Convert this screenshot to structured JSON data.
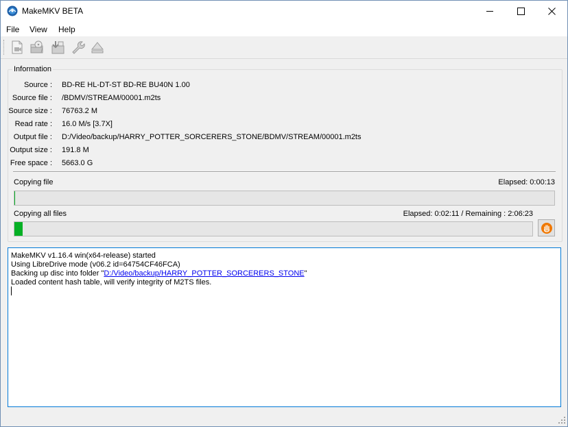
{
  "window": {
    "title": "MakeMKV BETA"
  },
  "title_buttons": {
    "minimize": "─",
    "maximize": "☐",
    "close": "✕"
  },
  "menu": {
    "file": "File",
    "view": "View",
    "help": "Help"
  },
  "toolbar": {
    "icons": [
      "open-files-icon",
      "open-disc-icon",
      "backup-icon",
      "preferences-icon",
      "eject-icon"
    ]
  },
  "info": {
    "group_title": "Information",
    "rows": [
      {
        "label": "Source :",
        "value": "BD-RE HL-DT-ST BD-RE BU40N 1.00"
      },
      {
        "label": "Source file :",
        "value": "/BDMV/STREAM/00001.m2ts"
      },
      {
        "label": "Source size :",
        "value": "76763.2 M"
      },
      {
        "label": "Read rate :",
        "value": "16.0 M/s [3.7X]"
      },
      {
        "label": "Output file :",
        "value": "D:/Video/backup/HARRY_POTTER_SORCERERS_STONE/BDMV/STREAM/00001.m2ts"
      },
      {
        "label": "Output size :",
        "value": "191.8 M"
      },
      {
        "label": "Free space :",
        "value": "5663.0 G"
      }
    ]
  },
  "progress": {
    "file_label": "Copying file",
    "file_elapsed": "Elapsed: 0:00:13",
    "file_fraction": 0.001,
    "all_label": "Copying all files",
    "all_elapsed": "Elapsed: 0:02:11 / Remaining : 2:06:23",
    "all_fraction": 0.016
  },
  "log": {
    "line1": "MakeMKV v1.16.4 win(x64-release) started",
    "line2": "Using LibreDrive mode (v06.2 id=64754CF46FCA)",
    "line3_prefix": "Backing up disc into folder \"",
    "line3_link": "D:/Video/backup/HARRY_POTTER_SORCERERS_STONE",
    "line3_suffix": "\"",
    "line4": "Loaded content hash table, will verify integrity of M2TS files."
  },
  "colors": {
    "progress_fill": "#06b025",
    "link": "#0000ee",
    "log_border": "#0078d7",
    "stop_orange": "#f07800"
  }
}
